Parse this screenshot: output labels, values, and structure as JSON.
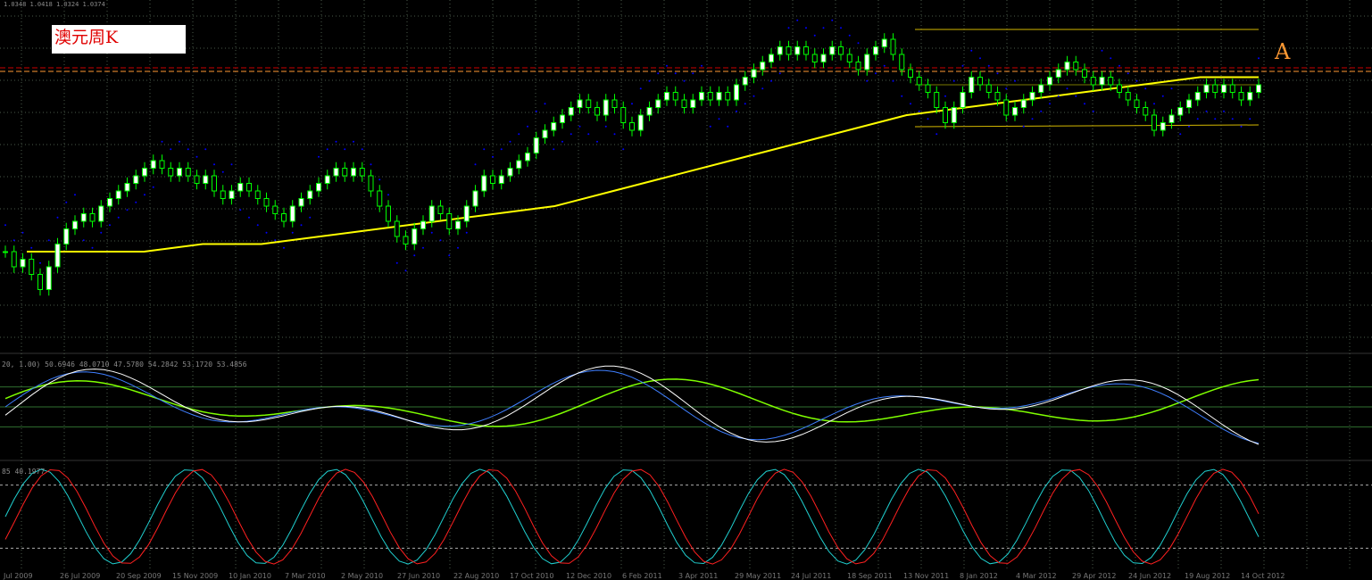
{
  "title": "澳元周K",
  "ohlc_readout": "1.0348 1.0418 1.0324 1.0374",
  "indicator1_readout": "20, 1.00) 50.6946 48.0710 47.5780 54.2842 53.1720 53.4856",
  "indicator2_readout": "85 40.1977",
  "marker_label": "A",
  "colors": {
    "background": "#000000",
    "grid": "#4a5a4a",
    "bull_candle": "#00ff00",
    "bull_body": "#ffffff",
    "ma": "#ffff00",
    "ma_blue": "#0000ff",
    "psar": "#0000ff",
    "fractal_up": "#ff0000",
    "fractal_down": "#1e90ff",
    "ref_line": "#cc0000",
    "ref_line2": "#ff9933",
    "channel": "#d4b800",
    "ind_white": "#ffffff",
    "ind_blue": "#3f7fff",
    "ind_green": "#7fff00",
    "stoch_red": "#ff2020",
    "stoch_cyan": "#20d0d0"
  },
  "chart_data": {
    "type": "candlestick",
    "x_tick_labels": [
      "Jul 2009",
      "26 Jul 2009",
      "20 Sep 2009",
      "15 Nov 2009",
      "10 Jan 2010",
      "7 Mar 2010",
      "2 May 2010",
      "27 Jun 2010",
      "22 Aug 2010",
      "17 Oct 2010",
      "12 Dec 2010",
      "6 Feb 2011",
      "3 Apr 2011",
      "29 May 2011",
      "24 Jul 2011",
      "18 Sep 2011",
      "13 Nov 2011",
      "8 Jan 2012",
      "4 Mar 2012",
      "29 Apr 2012",
      "24 Jun 2012",
      "19 Aug 2012",
      "14 Oct 2012"
    ],
    "closes": [
      0.82,
      0.8,
      0.81,
      0.79,
      0.77,
      0.8,
      0.83,
      0.85,
      0.86,
      0.87,
      0.86,
      0.88,
      0.89,
      0.9,
      0.91,
      0.92,
      0.93,
      0.94,
      0.93,
      0.92,
      0.93,
      0.92,
      0.91,
      0.92,
      0.9,
      0.89,
      0.9,
      0.91,
      0.9,
      0.89,
      0.88,
      0.87,
      0.86,
      0.88,
      0.89,
      0.9,
      0.91,
      0.92,
      0.93,
      0.92,
      0.93,
      0.92,
      0.9,
      0.88,
      0.86,
      0.84,
      0.83,
      0.85,
      0.86,
      0.88,
      0.87,
      0.85,
      0.86,
      0.88,
      0.9,
      0.92,
      0.91,
      0.92,
      0.93,
      0.94,
      0.95,
      0.97,
      0.98,
      0.99,
      1.0,
      1.01,
      1.02,
      1.01,
      1.0,
      1.02,
      1.01,
      0.99,
      0.98,
      1.0,
      1.01,
      1.02,
      1.03,
      1.02,
      1.01,
      1.02,
      1.03,
      1.02,
      1.03,
      1.02,
      1.04,
      1.05,
      1.06,
      1.07,
      1.08,
      1.09,
      1.08,
      1.09,
      1.08,
      1.07,
      1.08,
      1.09,
      1.08,
      1.07,
      1.06,
      1.08,
      1.09,
      1.1,
      1.08,
      1.06,
      1.05,
      1.04,
      1.03,
      1.01,
      0.99,
      1.01,
      1.03,
      1.05,
      1.04,
      1.03,
      1.02,
      1.0,
      1.01,
      1.02,
      1.03,
      1.04,
      1.05,
      1.06,
      1.07,
      1.06,
      1.05,
      1.04,
      1.05,
      1.04,
      1.03,
      1.02,
      1.01,
      1.0,
      0.98,
      0.99,
      1.0,
      1.01,
      1.02,
      1.03,
      1.04,
      1.03,
      1.04,
      1.03,
      1.02,
      1.03,
      1.04
    ],
    "ma_values": [
      0.82,
      0.82,
      0.82,
      0.83,
      0.83,
      0.84,
      0.85,
      0.86,
      0.87,
      0.88,
      0.9,
      0.92,
      0.94,
      0.96,
      0.98,
      1.0,
      1.01,
      1.02,
      1.03,
      1.04,
      1.05,
      1.05
    ],
    "stochastic_levels": [
      80,
      20
    ],
    "indicator1_levels": [
      70,
      50,
      30
    ]
  }
}
